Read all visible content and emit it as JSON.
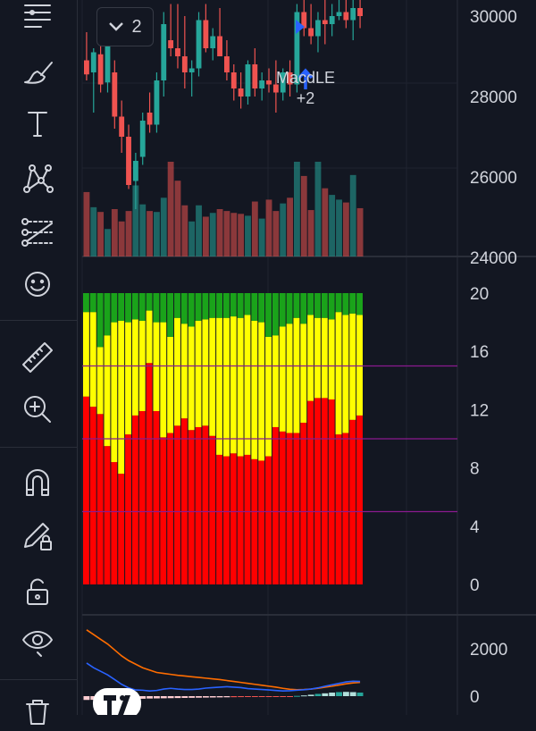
{
  "toolbar": {
    "tools": [
      "menu-lines-icon",
      "brush-icon",
      "text-icon",
      "pattern-icon",
      "fib-icon",
      "emoji-icon",
      "ruler-icon",
      "zoom-in-icon",
      "magnet-icon",
      "pencil-lock-icon",
      "lock-icon",
      "eye-icon",
      "trash-icon"
    ]
  },
  "price_pane": {
    "collapse_button": {
      "icon": "chevron-down-icon",
      "count": "2"
    },
    "signal": {
      "name": "MacdLE",
      "count": "+2",
      "arrow_color": "#2962ff"
    },
    "y_ticks": [
      "30000",
      "28000",
      "26000",
      "24000"
    ]
  },
  "volume_colors": {
    "up": "#26a69a",
    "down": "#ef5350"
  },
  "chart_data": [
    {
      "type": "candlestick",
      "ylim": [
        24000,
        30400
      ],
      "candles": [
        {
          "o": 28900,
          "h": 29600,
          "l": 28400,
          "c": 28550,
          "up": false
        },
        {
          "o": 28600,
          "h": 29200,
          "l": 27600,
          "c": 29100,
          "up": true
        },
        {
          "o": 29050,
          "h": 29400,
          "l": 28100,
          "c": 28300,
          "up": false
        },
        {
          "o": 28350,
          "h": 29700,
          "l": 28100,
          "c": 29500,
          "up": true
        },
        {
          "o": 28600,
          "h": 28900,
          "l": 27200,
          "c": 27500,
          "up": false
        },
        {
          "o": 27500,
          "h": 27900,
          "l": 26600,
          "c": 27000,
          "up": false
        },
        {
          "o": 27000,
          "h": 27300,
          "l": 25700,
          "c": 25800,
          "up": false
        },
        {
          "o": 25900,
          "h": 26600,
          "l": 25200,
          "c": 26400,
          "up": true
        },
        {
          "o": 26500,
          "h": 27600,
          "l": 26300,
          "c": 27400,
          "up": true
        },
        {
          "o": 27600,
          "h": 28100,
          "l": 27100,
          "c": 27300,
          "up": false
        },
        {
          "o": 27300,
          "h": 28600,
          "l": 27100,
          "c": 28400,
          "up": true
        },
        {
          "o": 28400,
          "h": 30100,
          "l": 28000,
          "c": 29800,
          "up": true
        },
        {
          "o": 29400,
          "h": 30300,
          "l": 29000,
          "c": 29200,
          "up": false
        },
        {
          "o": 29200,
          "h": 30300,
          "l": 28700,
          "c": 29000,
          "up": false
        },
        {
          "o": 29000,
          "h": 30000,
          "l": 28200,
          "c": 28600,
          "up": false
        },
        {
          "o": 28600,
          "h": 28900,
          "l": 28000,
          "c": 28700,
          "up": true
        },
        {
          "o": 28700,
          "h": 30100,
          "l": 28500,
          "c": 29900,
          "up": true
        },
        {
          "o": 29900,
          "h": 30300,
          "l": 29100,
          "c": 29200,
          "up": false
        },
        {
          "o": 29200,
          "h": 29700,
          "l": 28900,
          "c": 29500,
          "up": true
        },
        {
          "o": 29500,
          "h": 30200,
          "l": 29000,
          "c": 29000,
          "up": false
        },
        {
          "o": 29000,
          "h": 29400,
          "l": 28400,
          "c": 28600,
          "up": false
        },
        {
          "o": 28600,
          "h": 28800,
          "l": 27900,
          "c": 28200,
          "up": false
        },
        {
          "o": 28200,
          "h": 28600,
          "l": 27700,
          "c": 28000,
          "up": false
        },
        {
          "o": 28000,
          "h": 28900,
          "l": 27800,
          "c": 28800,
          "up": true
        },
        {
          "o": 28800,
          "h": 29200,
          "l": 28000,
          "c": 28200,
          "up": false
        },
        {
          "o": 28200,
          "h": 28600,
          "l": 27900,
          "c": 28400,
          "up": true
        },
        {
          "o": 28400,
          "h": 28700,
          "l": 28100,
          "c": 28300,
          "up": false
        },
        {
          "o": 28300,
          "h": 28900,
          "l": 27600,
          "c": 28100,
          "up": false
        },
        {
          "o": 28100,
          "h": 28700,
          "l": 27900,
          "c": 28600,
          "up": true
        },
        {
          "o": 28600,
          "h": 28900,
          "l": 28000,
          "c": 28300,
          "up": false
        },
        {
          "o": 28300,
          "h": 30300,
          "l": 28100,
          "c": 30100,
          "up": true
        },
        {
          "o": 30100,
          "h": 30400,
          "l": 29500,
          "c": 29700,
          "up": false
        },
        {
          "o": 29700,
          "h": 30300,
          "l": 29300,
          "c": 29500,
          "up": false
        },
        {
          "o": 29500,
          "h": 30100,
          "l": 29100,
          "c": 29900,
          "up": true
        },
        {
          "o": 29900,
          "h": 30400,
          "l": 29300,
          "c": 29800,
          "up": false
        },
        {
          "o": 29800,
          "h": 30300,
          "l": 29500,
          "c": 30000,
          "up": true
        },
        {
          "o": 30000,
          "h": 30400,
          "l": 29900,
          "c": 30100,
          "up": true
        },
        {
          "o": 30100,
          "h": 30400,
          "l": 29700,
          "c": 29900,
          "up": false
        },
        {
          "o": 29900,
          "h": 30400,
          "l": 29400,
          "c": 30200,
          "up": true
        },
        {
          "o": 30200,
          "h": 30400,
          "l": 29700,
          "c": 30000,
          "up": false
        }
      ],
      "volume": [
        0.68,
        0.52,
        0.47,
        0.29,
        0.5,
        0.37,
        0.48,
        0.75,
        0.55,
        0.48,
        0.47,
        0.62,
        1.0,
        0.8,
        0.54,
        0.37,
        0.54,
        0.42,
        0.46,
        0.5,
        0.48,
        0.46,
        0.45,
        0.43,
        0.58,
        0.4,
        0.6,
        0.48,
        0.56,
        0.62,
        1.0,
        0.85,
        0.49,
        1.0,
        0.72,
        0.65,
        0.6,
        0.57,
        0.86,
        0.51
      ]
    },
    {
      "type": "stacked-bar",
      "ylim": [
        0,
        21
      ],
      "y_ticks": [
        "20",
        "16",
        "12",
        "8",
        "4",
        "0"
      ],
      "reference_lines": [
        15,
        10,
        5
      ],
      "series": [
        {
          "color": "#ff0000",
          "values": [
            12.9,
            12.2,
            11.7,
            9.5,
            8.4,
            7.6,
            10.3,
            11.6,
            11.9,
            15.2,
            11.9,
            10.1,
            10.4,
            10.9,
            11.4,
            10.6,
            10.8,
            10.9,
            10.2,
            8.9,
            8.8,
            9.0,
            8.8,
            8.9,
            8.6,
            8.5,
            8.8,
            10.8,
            10.5,
            10.4,
            10.4,
            11.1,
            12.6,
            12.8,
            12.8,
            12.7,
            10.3,
            10.4,
            11.3,
            11.6
          ]
        },
        {
          "color": "#ffff00",
          "values": [
            5.8,
            6.5,
            4.6,
            7.6,
            9.6,
            10.5,
            7.7,
            6.6,
            6.2,
            3.6,
            6.1,
            7.9,
            6.6,
            7.4,
            6.5,
            7.1,
            7.3,
            7.3,
            8.1,
            9.4,
            9.5,
            9.4,
            9.5,
            9.6,
            9.5,
            9.5,
            8.2,
            6.3,
            7.2,
            7.5,
            7.9,
            6.8,
            5.9,
            5.5,
            5.5,
            5.5,
            8.4,
            8.1,
            7.3,
            6.9
          ]
        },
        {
          "color": "#1aa31a",
          "values": [
            1.3,
            1.3,
            3.7,
            2.9,
            2.0,
            1.9,
            2.0,
            1.8,
            1.9,
            1.2,
            2.0,
            2.0,
            3.0,
            1.7,
            2.1,
            2.3,
            1.9,
            1.8,
            1.7,
            1.7,
            1.7,
            1.6,
            1.7,
            1.5,
            1.9,
            2.0,
            3.0,
            2.9,
            2.3,
            2.1,
            1.7,
            2.1,
            1.5,
            1.7,
            1.7,
            1.8,
            1.3,
            1.5,
            1.4,
            1.5
          ]
        }
      ]
    },
    {
      "type": "line+histogram",
      "y_ticks": [
        "2000",
        "0"
      ],
      "series": [
        {
          "name": "",
          "color": "#ff6d00",
          "values": [
            2800,
            2600,
            2400,
            2200,
            1950,
            1700,
            1500,
            1350,
            1200,
            1100,
            1000,
            960,
            920,
            880,
            850,
            820,
            790,
            760,
            730,
            700,
            660,
            620,
            580,
            540,
            500,
            460,
            420,
            380,
            330,
            290,
            270,
            280,
            300,
            330,
            380,
            420,
            470,
            520,
            560,
            580
          ]
        },
        {
          "name": "",
          "color": "#2962ff",
          "values": [
            1400,
            1200,
            1050,
            900,
            700,
            500,
            350,
            260,
            250,
            220,
            240,
            300,
            330,
            300,
            280,
            280,
            300,
            340,
            360,
            380,
            400,
            380,
            360,
            320,
            300,
            280,
            260,
            240,
            220,
            230,
            250,
            270,
            300,
            350,
            420,
            480,
            540,
            600,
            630,
            620
          ]
        }
      ],
      "histogram": [
        -160,
        -155,
        -150,
        -145,
        -140,
        -135,
        -130,
        -120,
        -110,
        -100,
        -95,
        -90,
        -85,
        -80,
        -75,
        -70,
        -65,
        -60,
        -56,
        -52,
        -48,
        -44,
        -40,
        -36,
        -32,
        -28,
        -24,
        -20,
        -12,
        -4,
        12,
        30,
        60,
        95,
        120,
        150,
        170,
        180,
        170,
        150
      ]
    }
  ]
}
